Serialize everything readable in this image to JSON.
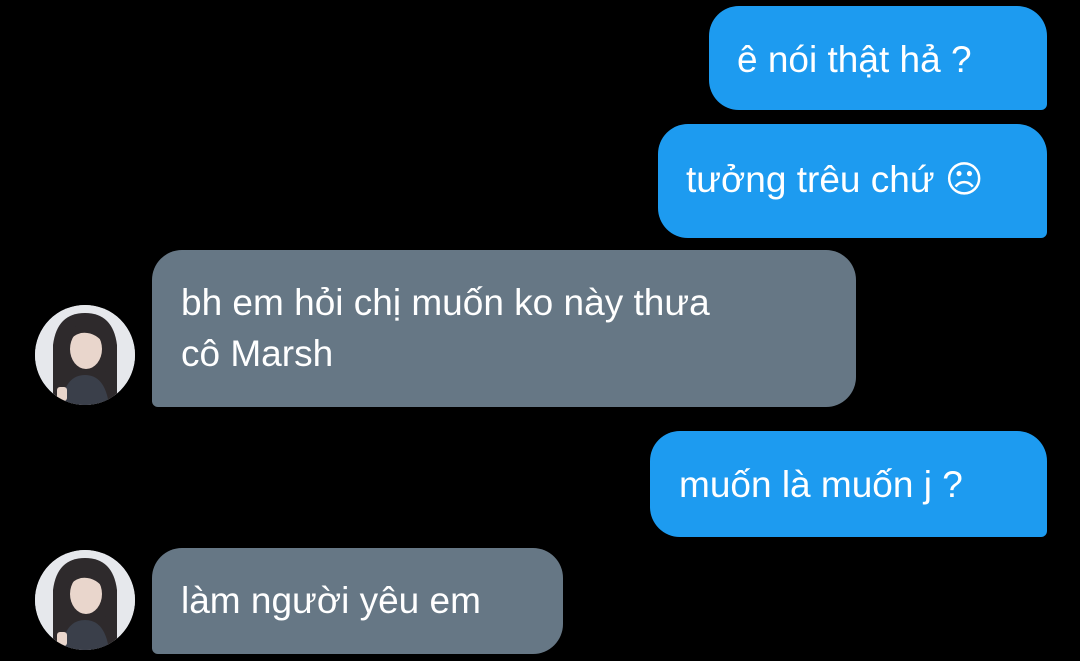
{
  "conversation": {
    "messages": [
      {
        "sender": "me",
        "text": "ê nói thật hả ?"
      },
      {
        "sender": "me",
        "text": "tưởng trêu chứ ☹"
      },
      {
        "sender": "other",
        "lines": [
          "bh em hỏi chị muốn ko này thưa",
          "cô Marsh"
        ]
      },
      {
        "sender": "me",
        "text": "muốn là muốn j ?"
      },
      {
        "sender": "other",
        "text": "làm người yêu em"
      }
    ],
    "colors": {
      "background": "#000000",
      "sent_bubble": "#1d9bf0",
      "received_bubble": "#667785",
      "text": "#ffffff"
    },
    "avatar_icon": "profile-photo"
  }
}
